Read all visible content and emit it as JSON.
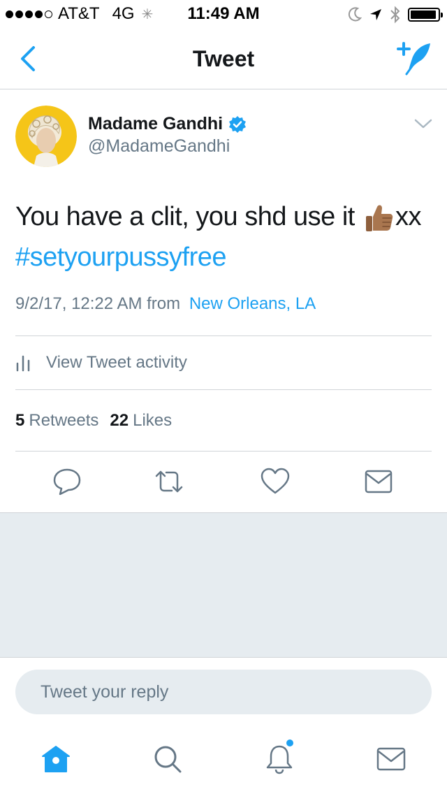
{
  "status_bar": {
    "carrier": "AT&T",
    "network": "4G",
    "time": "11:49 AM",
    "signal_bars_filled": 4,
    "signal_bars_total": 5,
    "battery_level": 0.95
  },
  "nav": {
    "title": "Tweet",
    "back_icon": "chevron-left-icon",
    "compose_icon": "compose-tweet-icon"
  },
  "tweet": {
    "author_name": "Madame Gandhi",
    "author_handle": "@MadameGandhi",
    "verified": true,
    "text_main": "You have a clit, you shd use it",
    "emoji": "thumbs-up-icon",
    "text_suffix": "xx",
    "hashtag": "#setyourpussyfree",
    "timestamp": "9/2/17, 12:22 AM",
    "from_label": "from",
    "location": "New Orleans, LA",
    "activity_label": "View Tweet activity",
    "retweets_count": "5",
    "retweets_label": "Retweets",
    "likes_count": "22",
    "likes_label": "Likes"
  },
  "actions": [
    "reply-icon",
    "retweet-icon",
    "like-icon",
    "direct-message-icon"
  ],
  "reply": {
    "placeholder": "Tweet your reply"
  },
  "tab_bar": {
    "tabs": [
      "home-icon",
      "search-icon",
      "notifications-icon",
      "messages-icon"
    ],
    "active": "home-icon",
    "notification_dot": true
  },
  "colors": {
    "accent": "#1da1f2",
    "text": "#14171a",
    "secondary": "#657786",
    "divider": "#d0d4d8",
    "background_gray": "#e6ecf0",
    "avatar_bg": "#f5c518"
  }
}
